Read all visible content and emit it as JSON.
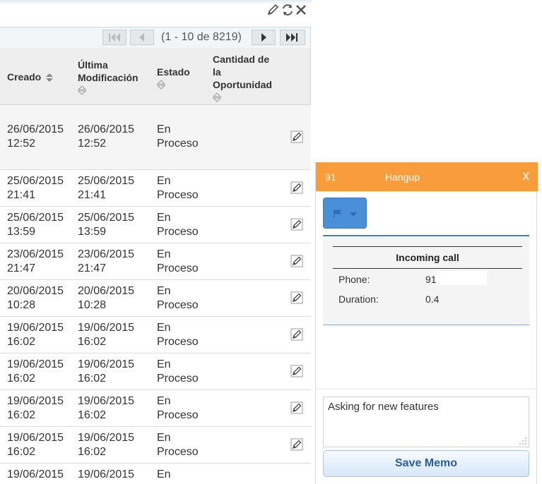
{
  "pager": {
    "info": "(1 - 10 de 8219)"
  },
  "table": {
    "headers": {
      "created": "Creado",
      "modified_line1": "Última",
      "modified_line2": "Modificación",
      "status": "Estado",
      "amount_line1": "Cantidad de",
      "amount_line2": "la",
      "amount_line3": "Oportunidad"
    },
    "rows": [
      {
        "created_date": "26/06/2015",
        "created_time": "12:52",
        "mod_date": "26/06/2015",
        "mod_time": "12:52",
        "status1": "En",
        "status2": "Proceso"
      },
      {
        "created_date": "25/06/2015",
        "created_time": "21:41",
        "mod_date": "25/06/2015",
        "mod_time": "21:41",
        "status1": "En",
        "status2": "Proceso"
      },
      {
        "created_date": "25/06/2015",
        "created_time": "13:59",
        "mod_date": "25/06/2015",
        "mod_time": "13:59",
        "status1": "En",
        "status2": "Proceso"
      },
      {
        "created_date": "23/06/2015",
        "created_time": "21:47",
        "mod_date": "23/06/2015",
        "mod_time": "21:47",
        "status1": "En",
        "status2": "Proceso"
      },
      {
        "created_date": "20/06/2015",
        "created_time": "10:28",
        "mod_date": "20/06/2015",
        "mod_time": "10:28",
        "status1": "En",
        "status2": "Proceso"
      },
      {
        "created_date": "19/06/2015",
        "created_time": "16:02",
        "mod_date": "19/06/2015",
        "mod_time": "16:02",
        "status1": "En",
        "status2": "Proceso"
      },
      {
        "created_date": "19/06/2015",
        "created_time": "16:02",
        "mod_date": "19/06/2015",
        "mod_time": "16:02",
        "status1": "En",
        "status2": "Proceso"
      },
      {
        "created_date": "19/06/2015",
        "created_time": "16:02",
        "mod_date": "19/06/2015",
        "mod_time": "16:02",
        "status1": "En",
        "status2": "Proceso"
      },
      {
        "created_date": "19/06/2015",
        "created_time": "16:02",
        "mod_date": "19/06/2015",
        "mod_time": "16:02",
        "status1": "En",
        "status2": "Proceso"
      },
      {
        "created_date": "19/06/2015",
        "created_time": "",
        "mod_date": "19/06/2015",
        "mod_time": "",
        "status1": "En",
        "status2": ""
      }
    ]
  },
  "call": {
    "number": "91",
    "hangup_label": "Hangup",
    "close_label": "x",
    "info_title": "Incoming call",
    "phone_label": "Phone:",
    "phone_value": "91",
    "duration_label": "Duration:",
    "duration_value": "0.4",
    "memo_text": "Asking for new features",
    "save_label": "Save Memo"
  },
  "colors": {
    "call_header": "#f89c3c",
    "flag_button": "#4a90d9",
    "save_text": "#2a5d9a"
  },
  "icons": {
    "window_tools": [
      "edit-icon",
      "refresh-icon",
      "close-icon"
    ],
    "row_action": "edit-icon",
    "flag": "flag-icon"
  }
}
